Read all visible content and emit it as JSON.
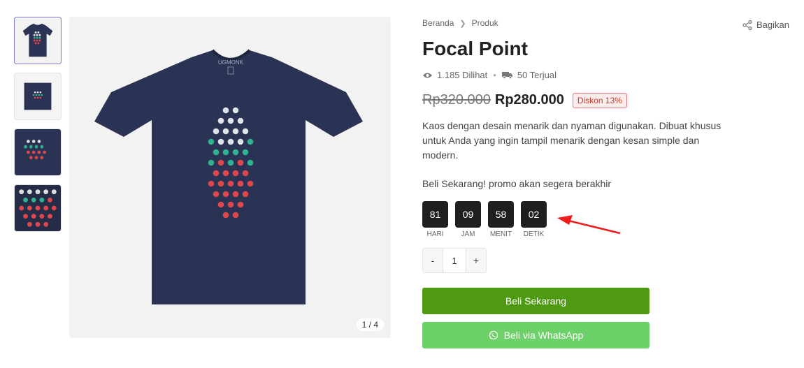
{
  "gallery": {
    "counter": "1 / 4",
    "brand_text": "UGMONK"
  },
  "breadcrumb": {
    "items": [
      "Beranda",
      "Produk"
    ]
  },
  "share_label": "Bagikan",
  "product": {
    "title": "Focal Point",
    "views": "1.185 Dilihat",
    "sold": "50 Terjual",
    "old_price": "Rp320.000",
    "price": "Rp280.000",
    "discount": "Diskon 13%",
    "description": "Kaos dengan desain menarik dan nyaman digunakan. Dibuat khusus untuk Anda yang ingin tampil menarik dengan kesan simple dan modern.",
    "promo_text": "Beli Sekarang! promo akan segera berakhir"
  },
  "countdown": [
    {
      "value": "81",
      "label": "HARI"
    },
    {
      "value": "09",
      "label": "JAM"
    },
    {
      "value": "58",
      "label": "MENIT"
    },
    {
      "value": "02",
      "label": "DETIK"
    }
  ],
  "quantity": {
    "minus": "-",
    "value": "1",
    "plus": "+"
  },
  "buttons": {
    "buy": "Beli Sekarang",
    "whatsapp": "Beli via WhatsApp"
  },
  "colors": {
    "buy": "#4e9a12",
    "whatsapp": "#6dd16a",
    "shirt": "#2b3354",
    "discount": "#c0392b"
  }
}
